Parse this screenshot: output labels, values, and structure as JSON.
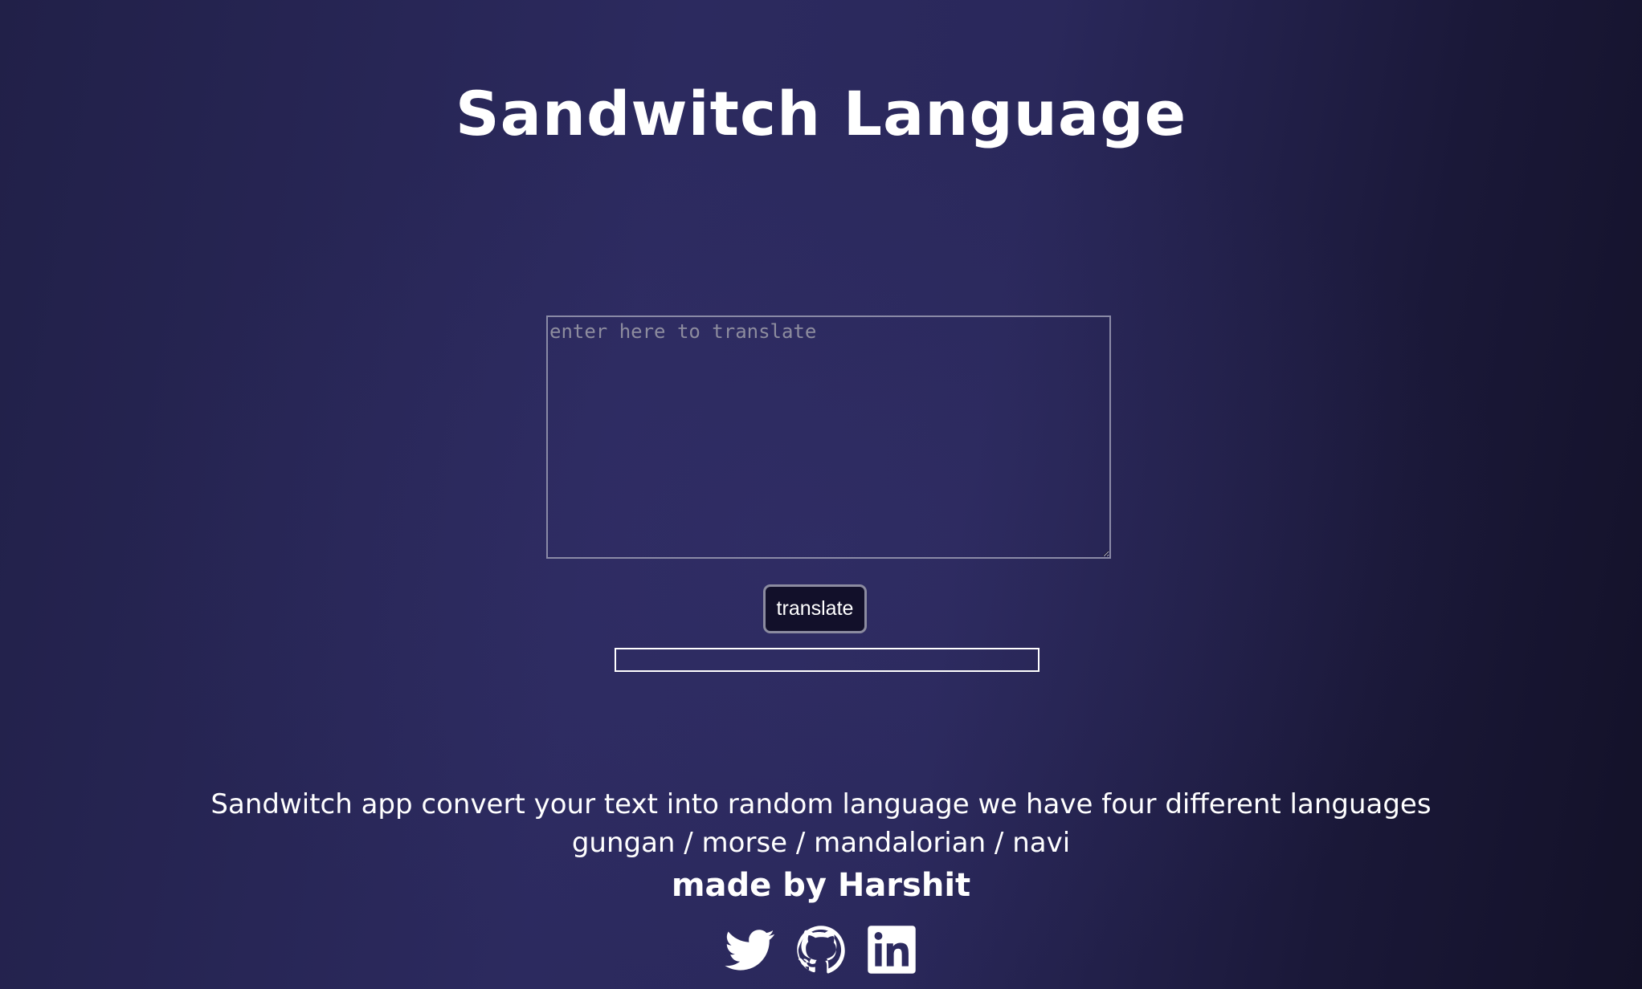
{
  "header": {
    "title": "Sandwitch Language"
  },
  "translator": {
    "input_placeholder": "enter here to translate",
    "input_value": "",
    "translate_label": "translate",
    "output_text": ""
  },
  "footer": {
    "description": "Sandwitch app convert your text into random language we have four different languages",
    "languages": "gungan / morse / mandalorian / navi",
    "credit": "made by Harshit"
  },
  "social": {
    "icons": [
      "twitter-icon",
      "github-icon",
      "linkedin-icon"
    ]
  },
  "colors": {
    "background_start": "#212048",
    "background_mid": "#2c2a5f",
    "background_end": "#131128",
    "button_background": "#12102a",
    "text": "#ffffff"
  }
}
